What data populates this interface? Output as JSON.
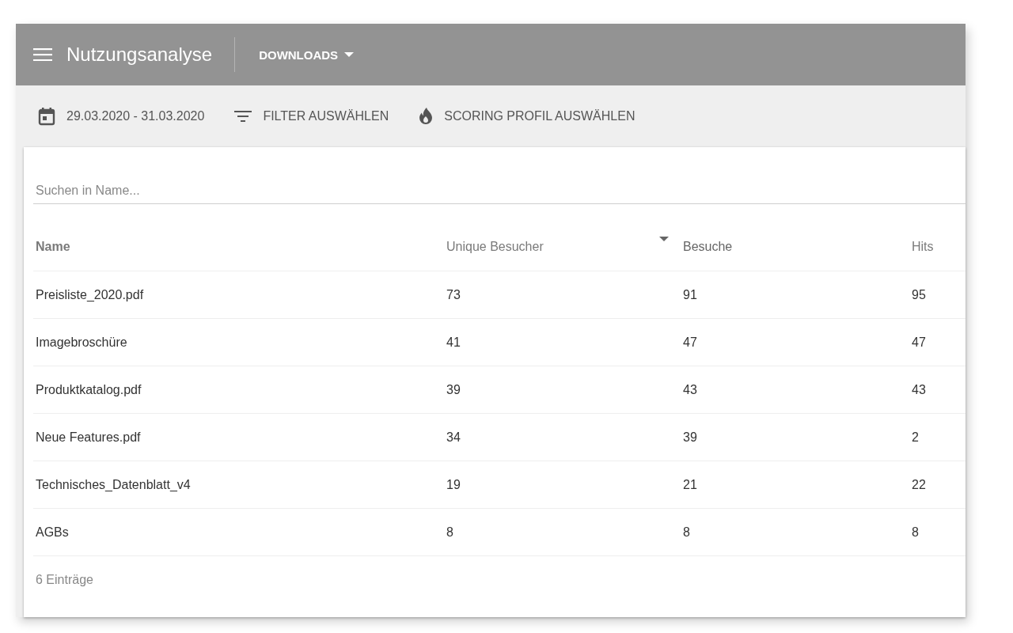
{
  "app_bar": {
    "title": "Nutzungsanalyse",
    "view": "DOWNLOADS"
  },
  "toolbar": [
    {
      "kind": "date",
      "label": "29.03.2020 - 31.03.2020"
    },
    {
      "kind": "filter",
      "label": "FILTER AUSWÄHLEN"
    },
    {
      "kind": "scoring",
      "label": "SCORING PROFIL AUSWÄHLEN"
    }
  ],
  "search": {
    "placeholder": "Suchen in Name..."
  },
  "table": {
    "columns": [
      {
        "label": "Name",
        "sorted": false
      },
      {
        "label": "Unique Besucher",
        "sorted": false
      },
      {
        "label": "Besuche",
        "sorted": true
      },
      {
        "label": "Hits",
        "sorted": false
      }
    ],
    "rows": [
      [
        "Preisliste_2020.pdf",
        "73",
        "91",
        "95"
      ],
      [
        "Imagebroschüre",
        "41",
        "47",
        "47"
      ],
      [
        "Produktkatalog.pdf",
        "39",
        "43",
        "43"
      ],
      [
        "Neue Features.pdf",
        "34",
        "39",
        "2"
      ],
      [
        "Technisches_Datenblatt_v4",
        "19",
        "21",
        "22"
      ],
      [
        "AGBs",
        "8",
        "8",
        "8"
      ]
    ]
  },
  "footer": "6 Einträge"
}
